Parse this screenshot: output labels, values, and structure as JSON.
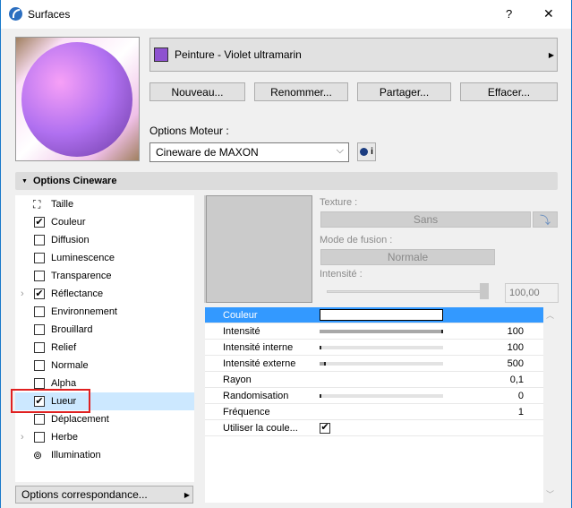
{
  "window": {
    "title": "Surfaces",
    "help": "?",
    "close": "✕"
  },
  "material": {
    "name": "Peinture - Violet ultramarin",
    "swatch": "#8e52d0"
  },
  "buttons": {
    "new": "Nouveau...",
    "rename": "Renommer...",
    "share": "Partager...",
    "delete": "Effacer..."
  },
  "engine": {
    "label": "Options Moteur :",
    "value": "Cineware de MAXON",
    "info": "i"
  },
  "section": {
    "title": "Options Cineware"
  },
  "channels": [
    {
      "label": "Taille",
      "type": "icon"
    },
    {
      "label": "Couleur",
      "checked": true
    },
    {
      "label": "Diffusion",
      "checked": false
    },
    {
      "label": "Luminescence",
      "checked": false
    },
    {
      "label": "Transparence",
      "checked": false
    },
    {
      "label": "Réflectance",
      "checked": true,
      "expandable": true
    },
    {
      "label": "Environnement",
      "checked": false
    },
    {
      "label": "Brouillard",
      "checked": false
    },
    {
      "label": "Relief",
      "checked": false
    },
    {
      "label": "Normale",
      "checked": false
    },
    {
      "label": "Alpha",
      "checked": false
    },
    {
      "label": "Lueur",
      "checked": true,
      "selected": true
    },
    {
      "label": "Déplacement",
      "checked": false
    },
    {
      "label": "Herbe",
      "checked": false,
      "expandable": true
    },
    {
      "label": "Illumination",
      "type": "icon"
    }
  ],
  "match_button": "Options correspondance...",
  "texture": {
    "label": "Texture :",
    "value": "Sans",
    "blend_label": "Mode de fusion :",
    "blend_value": "Normale",
    "intensity_label": "Intensité :",
    "intensity_value": "100,00",
    "intensity_fraction": 1.0
  },
  "params": [
    {
      "name": "Couleur",
      "type": "color",
      "color": "#ffffff"
    },
    {
      "name": "Intensité",
      "value": "100",
      "fraction": 1.0
    },
    {
      "name": "Intensité interne",
      "value": "100",
      "fraction": 0.01
    },
    {
      "name": "Intensité externe",
      "value": "500",
      "fraction": 0.05
    },
    {
      "name": "Rayon",
      "value": "0,1"
    },
    {
      "name": "Randomisation",
      "value": "0",
      "fraction": 0
    },
    {
      "name": "Fréquence",
      "value": "1"
    },
    {
      "name": "Utiliser la coule...",
      "type": "checkbox",
      "checked": true
    }
  ]
}
